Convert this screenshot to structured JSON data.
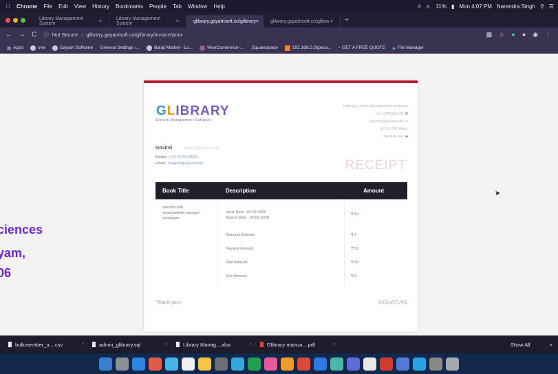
{
  "menubar": {
    "items": [
      "Chrome",
      "File",
      "Edit",
      "View",
      "History",
      "Bookmarks",
      "People",
      "Tab",
      "Window",
      "Help"
    ],
    "battery": "11%",
    "clock": "Mon 4:07 PM",
    "user": "Narendra Singh"
  },
  "tabs": [
    {
      "title": "Library Management System",
      "close": "×"
    },
    {
      "title": "Library Management System",
      "close": "×"
    },
    {
      "title": "glibrary.gayatrisoft.co/glibrary",
      "close": "×"
    },
    {
      "title": "glibrary.gayatrisoft.co/glibra",
      "close": "×"
    }
  ],
  "urlbar": {
    "back": "←",
    "forward": "→",
    "reload": "C",
    "security": "Not Secure",
    "url": "glibrary.gayatrisoft.co/glibrary/invoice/print"
  },
  "bookmarks": [
    "Apps",
    "one",
    "Gayatri Software",
    "General Settings ‹...",
    "Balaji Market ‹ Lo...",
    "WooCommerce ‹...",
    "Squarespace",
    "192.168.0.2/jpeca...",
    "GET A FREE QUOTE",
    "File Manager"
  ],
  "receipt": {
    "logo_g": "G",
    "logo_l": "L",
    "logo_rest": "IBRARY",
    "tagline": "Library Management Software",
    "company_lines": [
      "Glibrary Library Management Software",
      "+91 7240361235",
      "support@gayatrisoft.co",
      "SI 18 LTM MALL",
      "JAIPUR RAJ"
    ],
    "customer_name": "Govind",
    "customer_email_faint": "govind@yahoo.com",
    "mobile_label": "Mobile :",
    "mobile_value": "+91 8696158024",
    "email_label": "Email :",
    "email_value": "hkagrat@yahoo.com",
    "title": "RECEIPT",
    "headers": {
      "book": "Book Title",
      "description": "Description",
      "amount": "Amount"
    },
    "book_title": [
      "samidhi arth",
      "shastralabdhi narayan",
      "nathurami"
    ],
    "issue": "Issue Date : 04-02-2020",
    "submit": "Submit Date : 25-02-2020",
    "rows": [
      {
        "label": "Discount Amount:",
        "amount": "₹ 0"
      },
      {
        "label": "Payable Amount:",
        "amount": "₹ 50"
      },
      {
        "label": "Paid Amount:",
        "amount": "₹ 50"
      },
      {
        "label": "Due Amount:",
        "amount": "₹ 0"
      }
    ],
    "book_amount": "₹ 50",
    "thanks": "Thank you !",
    "signature": "SIGNATURE"
  },
  "left_text": [
    "ciences",
    "yam,",
    "06"
  ],
  "downloads": [
    {
      "name": "bulkmember_u....csv"
    },
    {
      "name": "admin_glibrary.sql"
    },
    {
      "name": "Library Manag....xlsx"
    },
    {
      "name": "Glibrary manua....pdf"
    }
  ],
  "show_all": "Show All",
  "close": "×"
}
